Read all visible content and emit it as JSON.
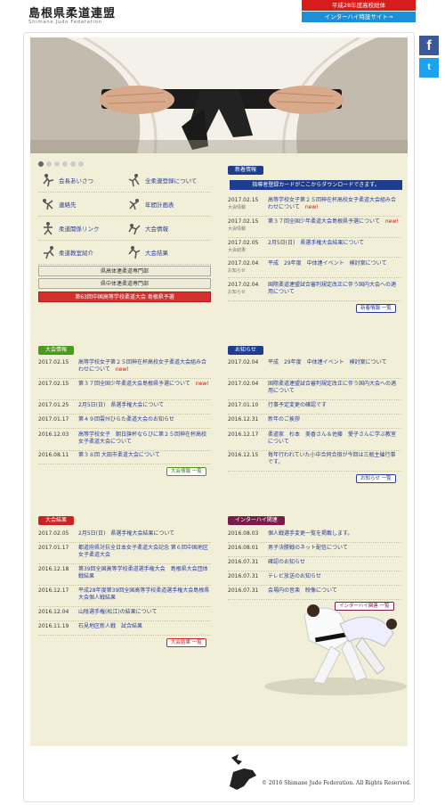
{
  "header": {
    "logo_title": "島根県柔道連盟",
    "logo_sub": "Shimane Judo Federation",
    "top_buttons": [
      "平成28年度高校総体",
      "インターハイ特設サイト→"
    ],
    "social": [
      "facebook-icon",
      "twitter-icon"
    ]
  },
  "slider": {
    "dots": 6,
    "active": 1
  },
  "menu": [
    {
      "label": "会長あいさつ",
      "icon": "judo-throw-icon"
    },
    {
      "label": "全柔連登録について",
      "icon": "judo-throw-icon"
    },
    {
      "label": "連絡先",
      "icon": "judo-throw-icon"
    },
    {
      "label": "年間計画表",
      "icon": "judo-throw-icon"
    },
    {
      "label": "柔道関係リンク",
      "icon": "judo-throw-icon"
    },
    {
      "label": "大会情報",
      "icon": "judo-throw-icon"
    },
    {
      "label": "柔道教室紹介",
      "icon": "judo-throw-icon"
    },
    {
      "label": "大会結果",
      "icon": "judo-throw-icon"
    }
  ],
  "side_buttons": [
    "県高体連柔道専門部",
    "県中体連柔道専門部",
    "第63回中国高等学校柔道大会 島根県予選"
  ],
  "news": {
    "heading": "新着情報",
    "download": "指導者登録カードがここからダウンロードできます。",
    "items": [
      {
        "date": "2017.02.15",
        "cat": "大会情報",
        "title": "高等学校女子第２５回神在杯高校女子柔道大会組み合わせについて",
        "new": "new!"
      },
      {
        "date": "2017.02.15",
        "cat": "大会情報",
        "title": "第３７回全国少年柔道大会島根県予選について",
        "new": "new!"
      },
      {
        "date": "2017.02.05",
        "cat": "大会結果",
        "title": "2月5日(日)　県選手権大会結果について",
        "new": ""
      },
      {
        "date": "2017.02.04",
        "cat": "お知らせ",
        "title": "平成　29年度　中体連イベント　検討案について",
        "new": ""
      },
      {
        "date": "2017.02.04",
        "cat": "お知らせ",
        "title": "国際柔道連盟試合審判規定改正に伴う国内大会への適用について",
        "new": ""
      }
    ],
    "more": "新着情報 一覧"
  },
  "taikai": {
    "heading": "大会情報",
    "items": [
      {
        "date": "2017.02.15",
        "title": "高等学校女子第２５回神在杯高校女子柔道大会組み合わせについて",
        "new": "new!"
      },
      {
        "date": "2017.02.15",
        "title": "第３７回全国少年柔道大会島根県予選について",
        "new": "new!"
      },
      {
        "date": "2017.01.25",
        "title": "2月5日(日)　県選手権大会について",
        "new": ""
      },
      {
        "date": "2017.01.17",
        "title": "第４９回雲州ひらた柔道大会のお知らせ",
        "new": ""
      },
      {
        "date": "2016.12.03",
        "title": "高等学校女子　朝日旗杯ならびに第２５回神在杯高校女子柔道大会について",
        "new": ""
      },
      {
        "date": "2016.08.11",
        "title": "第３８回 大田市柔道大会について",
        "new": ""
      }
    ],
    "more": "大会情報 一覧"
  },
  "oshirase": {
    "heading": "お知らせ",
    "items": [
      {
        "date": "2017.02.04",
        "title": "平成　29年度　中体連イベント　検討案について"
      },
      {
        "date": "2017.02.04",
        "title": "国際柔道連盟試合審判規定改正に伴う国内大会への適用について"
      },
      {
        "date": "2017.01.10",
        "title": "行事予定変更の確認です"
      },
      {
        "date": "2016.12.31",
        "title": "新年のご挨拶"
      },
      {
        "date": "2016.12.17",
        "title": "柔道家　杉本　美香さん＆佐藤　愛子さんに学ぶ教室について"
      },
      {
        "date": "2016.12.15",
        "title": "毎年行われていた小中合同合宿が今回は三瓶主催行事です。"
      }
    ],
    "more": "お知らせ 一覧"
  },
  "kekka": {
    "heading": "大会結果",
    "items": [
      {
        "date": "2017.02.05",
        "title": "2月5日(日)　県選手権大会結果について"
      },
      {
        "date": "2017.01.17",
        "title": "都道府県対抗全日本女子柔道大会記念 第６回中国地区女子柔道大会"
      },
      {
        "date": "2016.12.18",
        "title": "第39回全国高等学校柔道選手権大会　島根県大会団体戦結果"
      },
      {
        "date": "2016.12.17",
        "title": "平成28年度第39回全国高等学校柔道選手権大会島根県大会個人戦結果"
      },
      {
        "date": "2016.12.04",
        "title": "山陰選手権(松江)の結果について"
      },
      {
        "date": "2016.11.19",
        "title": "石見地区新人戦　試合結果"
      }
    ],
    "more": "大会結果 一覧"
  },
  "interhigh": {
    "heading": "インターハイ関連",
    "items": [
      {
        "date": "2016.08.03",
        "title": "個人戦選手変更一覧を掲載します。"
      },
      {
        "date": "2016.08.01",
        "title": "男子決勝戦のネット配信について"
      },
      {
        "date": "2016.07.31",
        "title": "確認のお知らせ"
      },
      {
        "date": "2016.07.31",
        "title": "テレビ放送のお知らせ"
      },
      {
        "date": "2016.07.31",
        "title": "会場内の音楽　映像について"
      }
    ],
    "more": "インターハイ関連 一覧"
  },
  "footer": {
    "copyright": "© 2016 Shimane Judo Federation. All Rights Reserved."
  },
  "colors": {
    "bg": "#f2efd9",
    "navy": "#1f3d8f",
    "green": "#4b9a1d",
    "red": "#cc2222",
    "purple": "#7a1b4d",
    "link": "#2a3b9a"
  }
}
